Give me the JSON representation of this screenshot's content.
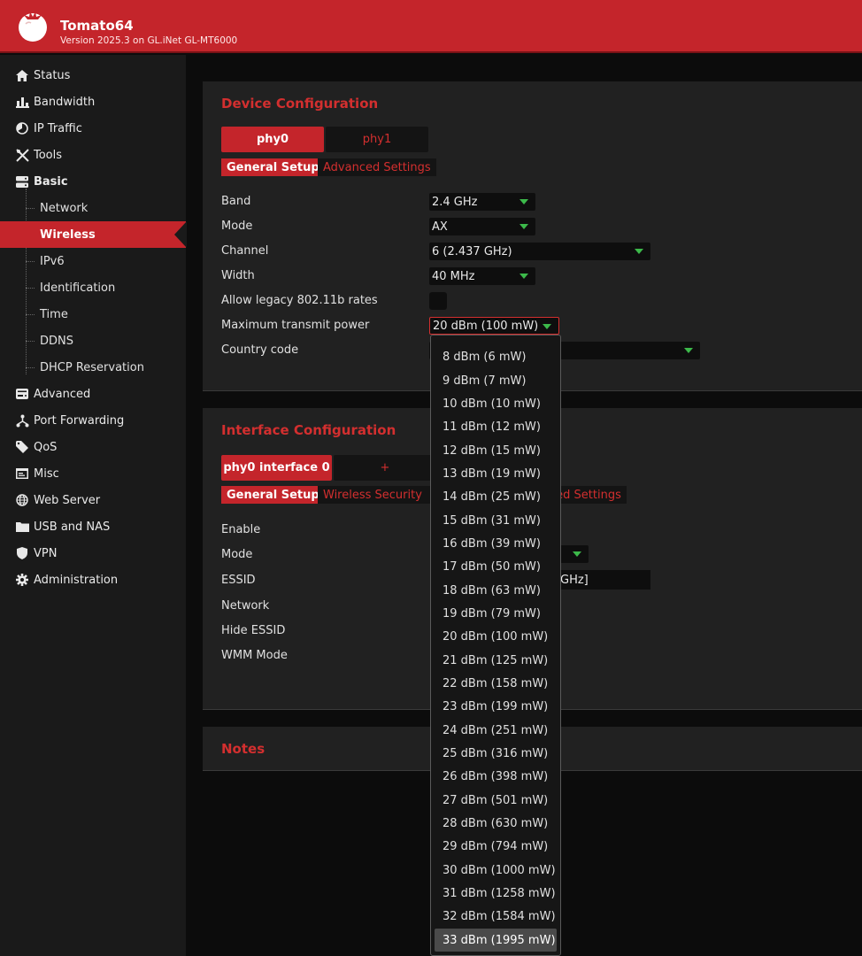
{
  "header": {
    "title": "Tomato64",
    "version": "Version 2025.3 on GL.iNet GL-MT6000"
  },
  "sidebar": {
    "items": [
      {
        "label": "Status",
        "icon": "home-icon"
      },
      {
        "label": "Bandwidth",
        "icon": "bar-chart-icon"
      },
      {
        "label": "IP Traffic",
        "icon": "pie-icon"
      },
      {
        "label": "Tools",
        "icon": "tools-icon"
      },
      {
        "label": "Basic",
        "icon": "server-icon"
      },
      {
        "label": "Advanced",
        "icon": "hdd-icon"
      },
      {
        "label": "Port Forwarding",
        "icon": "network-icon"
      },
      {
        "label": "QoS",
        "icon": "tag-icon"
      },
      {
        "label": "Misc",
        "icon": "window-icon"
      },
      {
        "label": "Web Server",
        "icon": "globe-icon"
      },
      {
        "label": "USB and NAS",
        "icon": "folder-icon"
      },
      {
        "label": "VPN",
        "icon": "shield-icon"
      },
      {
        "label": "Administration",
        "icon": "gear-icon"
      }
    ],
    "basic_sub": [
      "Network",
      "Wireless",
      "IPv6",
      "Identification",
      "Time",
      "DDNS",
      "DHCP Reservation"
    ],
    "active_sub": "Wireless"
  },
  "device": {
    "title": "Device Configuration",
    "tabs": [
      "phy0",
      "phy1"
    ],
    "subtabs": [
      "General Setup",
      "Advanced Settings"
    ],
    "labels": {
      "band": "Band",
      "mode": "Mode",
      "channel": "Channel",
      "width": "Width",
      "legacy": "Allow legacy 802.11b rates",
      "txpower": "Maximum transmit power",
      "country": "Country code"
    },
    "values": {
      "band": "2.4 GHz",
      "mode": "AX",
      "channel": "6 (2.437 GHz)",
      "width": "40 MHz",
      "txpower": "20 dBm (100 mW)"
    }
  },
  "interface": {
    "title": "Interface Configuration",
    "tabs": [
      "phy0 interface 0",
      "+"
    ],
    "subtabs": [
      "General Setup",
      "Wireless Security",
      "ced Settings"
    ],
    "labels": {
      "enable": "Enable",
      "mode": "Mode",
      "essid": "ESSID",
      "network": "Network",
      "hide": "Hide ESSID",
      "wmm": "WMM Mode"
    },
    "essid_tail": "GHz]"
  },
  "notes": {
    "title": "Notes"
  },
  "txpower_options": [
    "8 dBm (6 mW)",
    "9 dBm (7 mW)",
    "10 dBm (10 mW)",
    "11 dBm (12 mW)",
    "12 dBm (15 mW)",
    "13 dBm (19 mW)",
    "14 dBm (25 mW)",
    "15 dBm (31 mW)",
    "16 dBm (39 mW)",
    "17 dBm (50 mW)",
    "18 dBm (63 mW)",
    "19 dBm (79 mW)",
    "20 dBm (100 mW)",
    "21 dBm (125 mW)",
    "22 dBm (158 mW)",
    "23 dBm (199 mW)",
    "24 dBm (251 mW)",
    "25 dBm (316 mW)",
    "26 dBm (398 mW)",
    "27 dBm (501 mW)",
    "28 dBm (630 mW)",
    "29 dBm (794 mW)",
    "30 dBm (1000 mW)",
    "31 dBm (1258 mW)",
    "32 dBm (1584 mW)",
    "33 dBm (1995 mW)"
  ],
  "highlighted_option": "33 dBm (1995 mW)",
  "colors": {
    "accent": "#c4252b",
    "arrow": "#3cb94a",
    "background": "#0c0c0c",
    "panel": "#212121"
  }
}
